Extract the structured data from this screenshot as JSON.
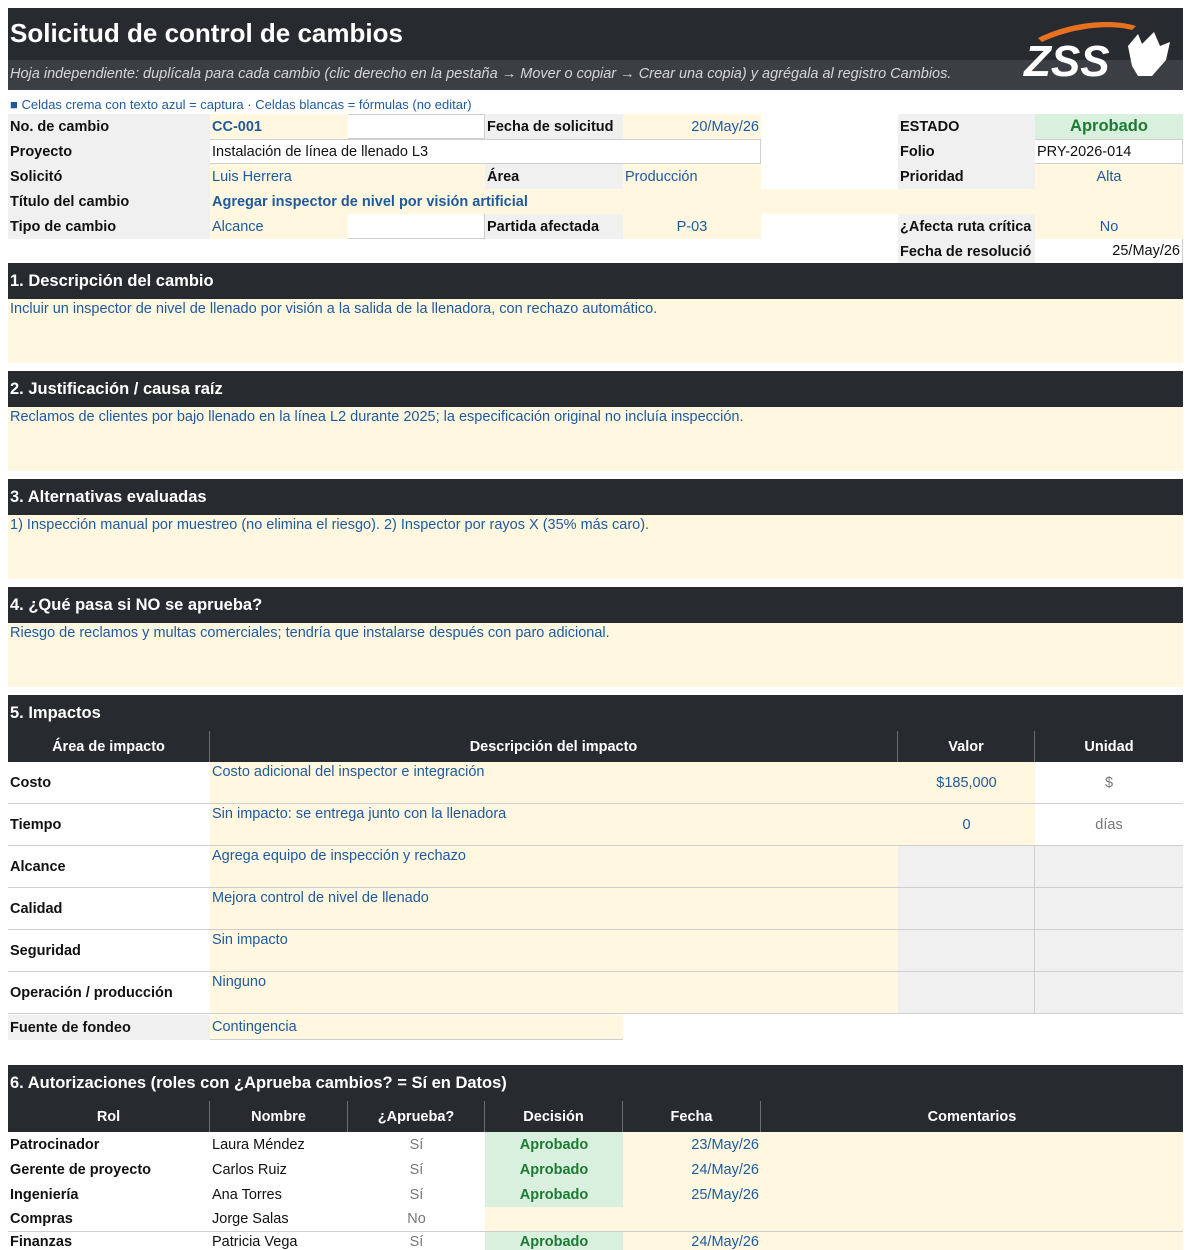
{
  "header": {
    "title": "Solicitud de control de cambios",
    "subtitle": "Hoja independiente: duplícala para cada cambio (clic derecho en la pestaña → Mover o copiar → Crear una copia) y agrégala al registro Cambios.",
    "logo_text": "ZSS"
  },
  "legend": "■ Celdas crema con texto azul = captura   ·   Celdas blancas = fórmulas (no editar)",
  "info": {
    "no_cambio_label": "No. de cambio",
    "no_cambio": "CC-001",
    "fecha_solicitud_label": "Fecha de solicitud",
    "fecha_solicitud": "20/May/26",
    "estado_label": "ESTADO",
    "estado": "Aprobado",
    "proyecto_label": "Proyecto",
    "proyecto": "Instalación de línea de llenado L3",
    "folio_label": "Folio",
    "folio": "PRY-2026-014",
    "solicito_label": "Solicitó",
    "solicito": "Luis Herrera",
    "area_label": "Área",
    "area": "Producción",
    "prioridad_label": "Prioridad",
    "prioridad": "Alta",
    "titulo_label": "Título del cambio",
    "titulo": "Agregar inspector de nivel por visión artificial",
    "tipo_label": "Tipo de cambio",
    "tipo": "Alcance",
    "partida_label": "Partida afectada",
    "partida": "P-03",
    "ruta_label": "¿Afecta ruta crítica",
    "ruta": "No",
    "resolucion_label": "Fecha de resolució",
    "resolucion": "25/May/26"
  },
  "sections": {
    "s1_title": "1. Descripción del cambio",
    "s1_text": "Incluir un inspector de nivel de llenado por visión a la salida de la llenadora, con rechazo automático.",
    "s2_title": "2. Justificación / causa raíz",
    "s2_text": "Reclamos de clientes por bajo llenado en la línea L2 durante 2025; la especificación original no incluía inspección.",
    "s3_title": "3. Alternativas evaluadas",
    "s3_text": "1) Inspección manual por muestreo (no elimina el riesgo). 2) Inspector por rayos X (35% más caro).",
    "s4_title": "4. ¿Qué pasa si NO se aprueba?",
    "s4_text": "Riesgo de reclamos y multas comerciales; tendría que instalarse después con paro adicional.",
    "s5_title": "5. Impactos",
    "s6_title": "6. Autorizaciones (roles con ¿Aprueba cambios? = Sí en Datos)"
  },
  "impacts": {
    "headers": [
      "Área de impacto",
      "Descripción del impacto",
      "Valor",
      "Unidad"
    ],
    "rows": [
      {
        "area": "Costo",
        "desc": "Costo adicional del inspector e integración",
        "valor": "$185,000",
        "unidad": "$"
      },
      {
        "area": "Tiempo",
        "desc": "Sin impacto: se entrega junto con la llenadora",
        "valor": "0",
        "unidad": "días"
      },
      {
        "area": "Alcance",
        "desc": "Agrega equipo de inspección y rechazo",
        "valor": "",
        "unidad": ""
      },
      {
        "area": "Calidad",
        "desc": "Mejora control de nivel de llenado",
        "valor": "",
        "unidad": ""
      },
      {
        "area": "Seguridad",
        "desc": "Sin impacto",
        "valor": "",
        "unidad": ""
      },
      {
        "area": "Operación / producción",
        "desc": "Ninguno",
        "valor": "",
        "unidad": ""
      }
    ],
    "fondeo_label": "Fuente de fondeo",
    "fondeo": "Contingencia"
  },
  "auth": {
    "headers": [
      "Rol",
      "Nombre",
      "¿Aprueba?",
      "Decisión",
      "Fecha",
      "Comentarios"
    ],
    "rows": [
      {
        "rol": "Patrocinador",
        "nombre": "Laura Méndez",
        "aprueba": "Sí",
        "decision": "Aprobado",
        "fecha": "23/May/26",
        "comentarios": ""
      },
      {
        "rol": "Gerente de proyecto",
        "nombre": "Carlos Ruiz",
        "aprueba": "Sí",
        "decision": "Aprobado",
        "fecha": "24/May/26",
        "comentarios": ""
      },
      {
        "rol": "Ingeniería",
        "nombre": "Ana Torres",
        "aprueba": "Sí",
        "decision": "Aprobado",
        "fecha": "25/May/26",
        "comentarios": ""
      },
      {
        "rol": "Compras",
        "nombre": "Jorge Salas",
        "aprueba": "No",
        "decision": "",
        "fecha": "",
        "comentarios": ""
      },
      {
        "rol": "Finanzas",
        "nombre": "Patricia Vega",
        "aprueba": "Sí",
        "decision": "Aprobado",
        "fecha": "24/May/26",
        "comentarios": ""
      }
    ]
  },
  "colors": {
    "header_dark": "#272b30",
    "input_cream": "#fff7e0",
    "input_blue": "#1f5a9e",
    "approved_green": "#1e7a33",
    "approved_bg": "#d9f0df",
    "logo_orange": "#e8701e"
  }
}
